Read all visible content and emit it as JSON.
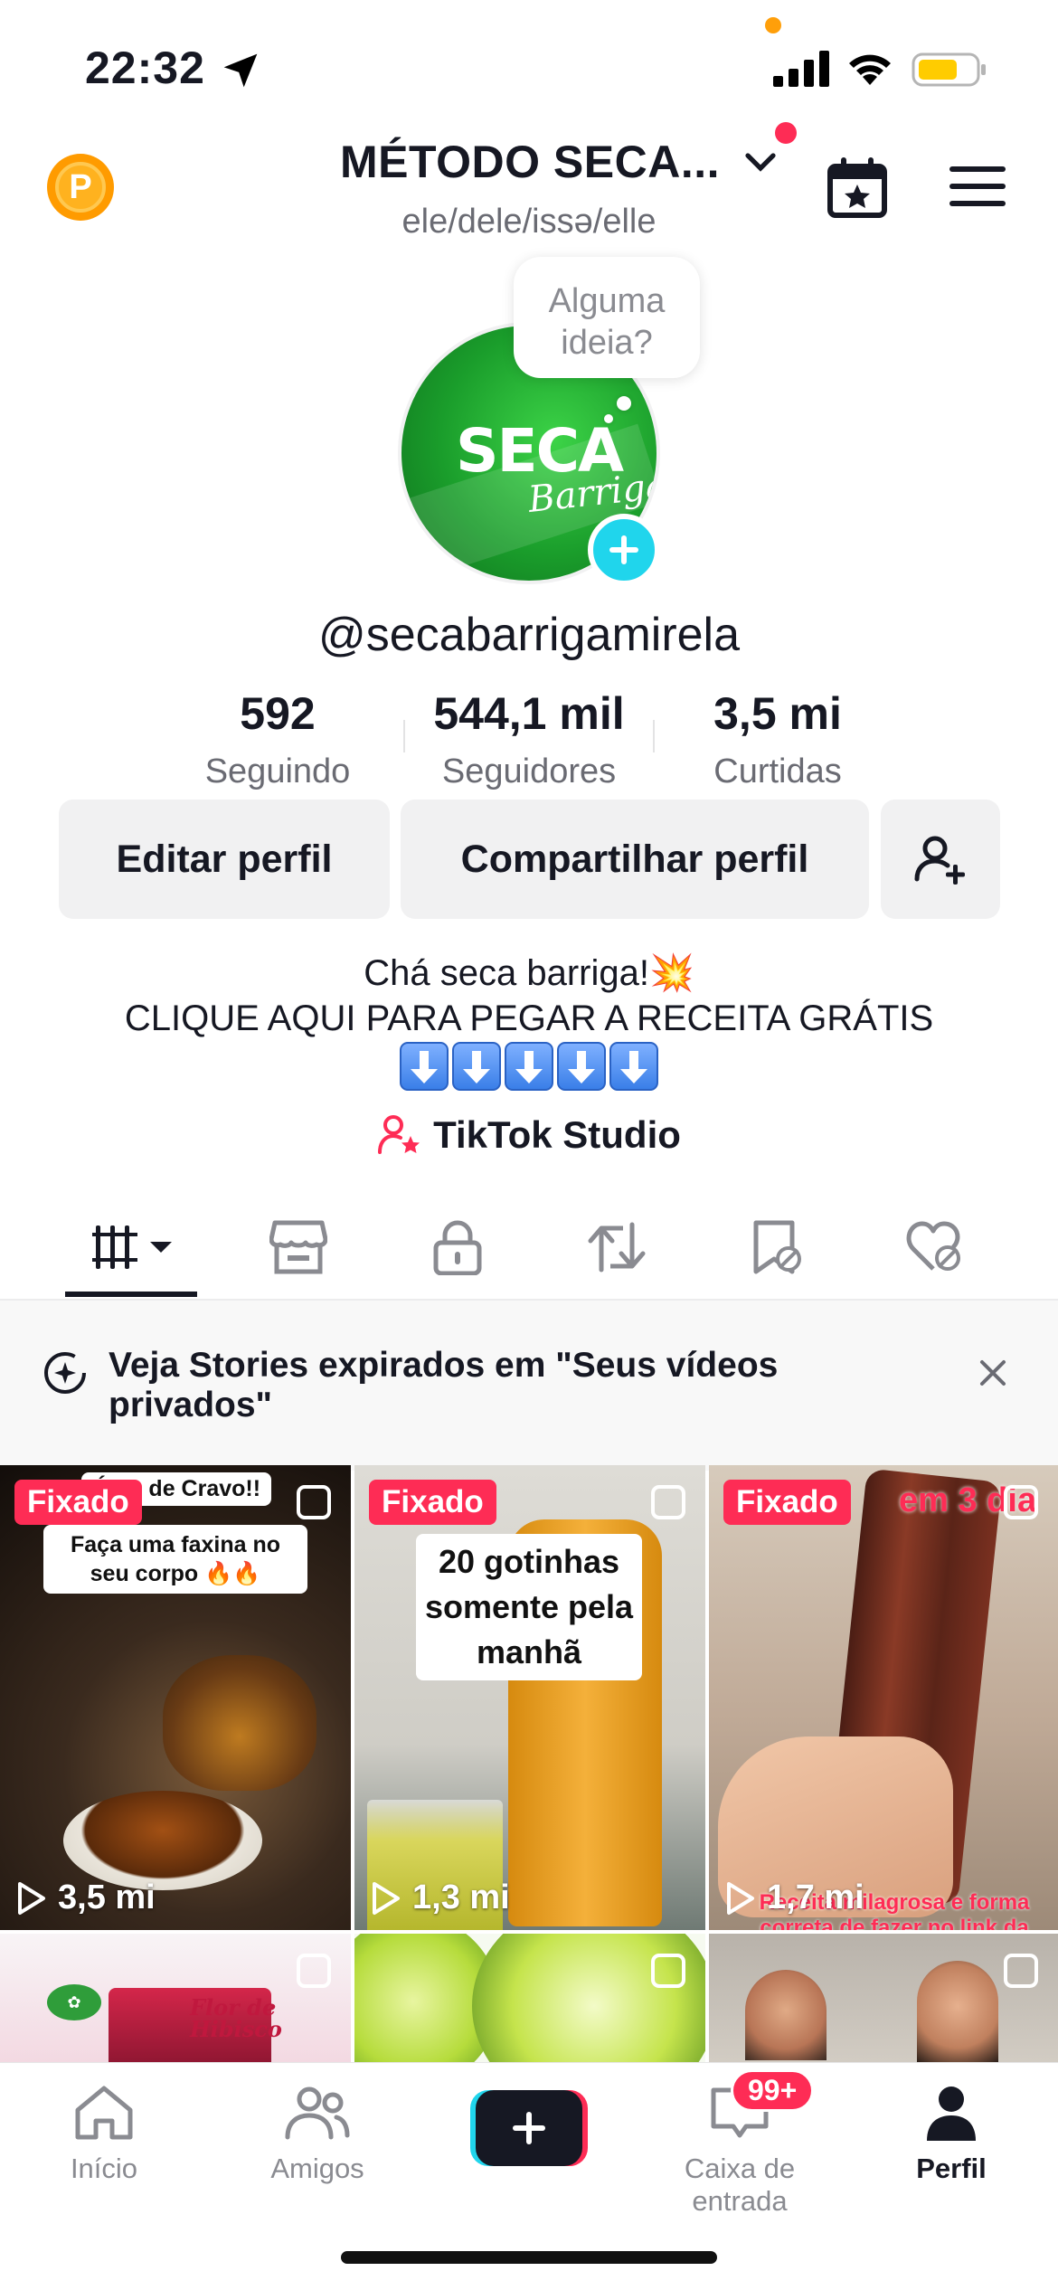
{
  "status_bar": {
    "time": "22:32"
  },
  "header": {
    "account_title": "MÉTODO SECA...",
    "pronouns": "ele/dele/issə/elle",
    "coin_letter": "P"
  },
  "avatar": {
    "bubble_text_line1": "Alguma",
    "bubble_text_line2": "ideia?",
    "logo_word1": "SECA",
    "logo_word2": "Barriga"
  },
  "profile": {
    "username": "@secabarrigamirela"
  },
  "stats": [
    {
      "value": "592",
      "label": "Seguindo"
    },
    {
      "value": "544,1 mil",
      "label": "Seguidores"
    },
    {
      "value": "3,5 mi",
      "label": "Curtidas"
    }
  ],
  "buttons": {
    "edit": "Editar perfil",
    "share": "Compartilhar perfil"
  },
  "bio": {
    "line1": "Chá seca barriga!💥",
    "line2": "CLIQUE AQUI PARA PEGAR A RECEITA GRÁTIS",
    "studio": "TikTok Studio"
  },
  "notice": {
    "text": "Veja Stories expirados em \"Seus vídeos privados\""
  },
  "videos": [
    {
      "pinned": "Fixado",
      "views": "3,5 mi",
      "caption_top": "Óleo de Cravo!!",
      "caption": "Faça uma faxina no seu corpo 🔥🔥"
    },
    {
      "pinned": "Fixado",
      "views": "1,3 mi",
      "caption": "20 gotinhas somente pela manhã"
    },
    {
      "pinned": "Fixado",
      "views": "1,7 mi",
      "caption_top": "em 3 dia",
      "caption_bottom": "Receita milagrosa e forma correta de fazer no link da"
    },
    {
      "caption": "Flor de Hibisco"
    },
    {},
    {}
  ],
  "bottom_nav": {
    "home": "Início",
    "friends": "Amigos",
    "inbox": "Caixa de entrada",
    "inbox_badge": "99+",
    "profile": "Perfil"
  },
  "colors": {
    "accent": "#fe2c55",
    "cyan": "#20d5ec",
    "text": "#161823",
    "muted": "#6a6b73",
    "button_bg": "#f1f1f2"
  }
}
